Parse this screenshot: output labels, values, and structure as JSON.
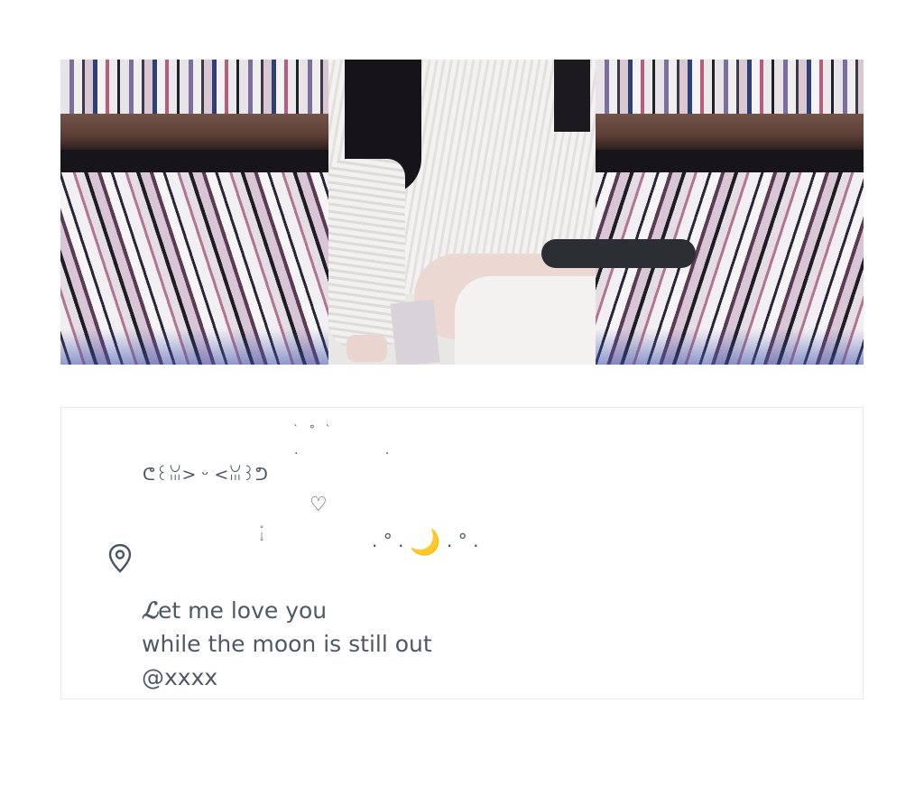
{
  "profile": {
    "decor": {
      "sparkle_top": "` ° `",
      "dots_top": ". .",
      "script_line": "ᕦ꒰ꈍ> ᵕ <ꈍ꒱ᕤ",
      "heart": "♡",
      "dot_line": "° ⁞ °",
      "moon_line": ". ° .",
      "moon_line_tail": ". ° .",
      "moon": "🌙"
    },
    "bio": {
      "line1_first_letter": "ℒ",
      "line1_rest": "et me love you",
      "line2": "while the moon is still out",
      "line3": "@xxxx"
    },
    "location_icon": "map-pin-icon"
  },
  "colors": {
    "text": "#4a5563",
    "moon": "#f2b632",
    "redaction": "#2b2e33",
    "card_border": "#e7e9ec"
  }
}
